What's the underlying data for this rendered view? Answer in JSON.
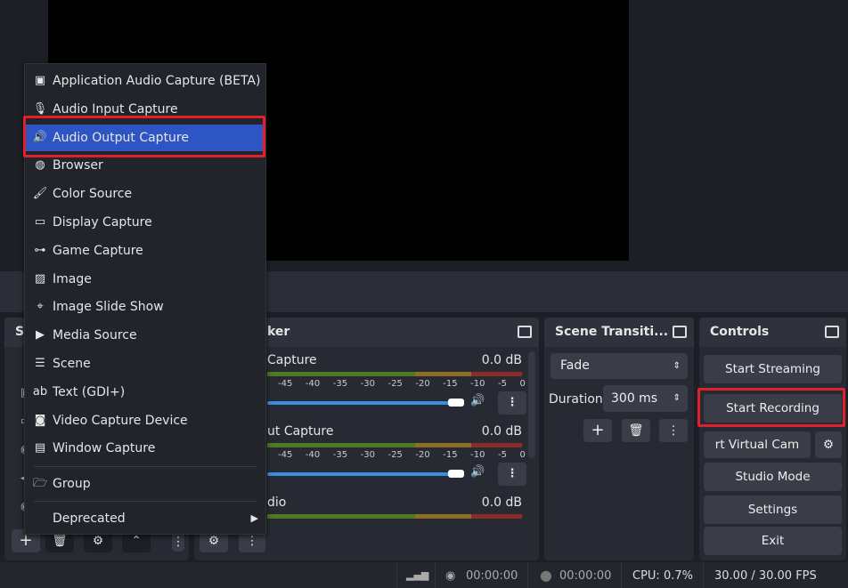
{
  "menu": {
    "items": [
      {
        "label": "Application Audio Capture (BETA)",
        "icon": "app-audio-icon"
      },
      {
        "label": "Audio Input Capture",
        "icon": "microphone-icon"
      },
      {
        "label": "Audio Output Capture",
        "icon": "speaker-icon",
        "selected": true
      },
      {
        "label": "Browser",
        "icon": "globe-icon"
      },
      {
        "label": "Color Source",
        "icon": "brush-icon"
      },
      {
        "label": "Display Capture",
        "icon": "monitor-icon"
      },
      {
        "label": "Game Capture",
        "icon": "gamepad-icon"
      },
      {
        "label": "Image",
        "icon": "image-icon"
      },
      {
        "label": "Image Slide Show",
        "icon": "slideshow-icon"
      },
      {
        "label": "Media Source",
        "icon": "play-icon"
      },
      {
        "label": "Scene",
        "icon": "list-icon"
      },
      {
        "label": "Text (GDI+)",
        "icon": "text-icon"
      },
      {
        "label": "Video Capture Device",
        "icon": "camera-icon"
      },
      {
        "label": "Window Capture",
        "icon": "window-icon"
      }
    ],
    "group": "Group",
    "deprecated": "Deprecated"
  },
  "sources": {
    "title": "S"
  },
  "mixer": {
    "title": "ker",
    "channels": [
      {
        "name": "Capture",
        "db": "0.0 dB"
      },
      {
        "name": "ut Capture",
        "db": "0.0 dB"
      },
      {
        "name": "dio",
        "db": "0.0 dB"
      }
    ],
    "ticks": [
      "-45",
      "-40",
      "-35",
      "-30",
      "-25",
      "-20",
      "-15",
      "-10",
      "-5",
      "0"
    ]
  },
  "transitions": {
    "title": "Scene Transiti...",
    "selected": "Fade",
    "duration_label": "Duration",
    "duration": "300 ms"
  },
  "controls": {
    "title": "Controls",
    "start_streaming": "Start Streaming",
    "start_recording": "Start Recording",
    "virtual_cam": "rt Virtual Cam",
    "studio_mode": "Studio Mode",
    "settings": "Settings",
    "exit": "Exit"
  },
  "status": {
    "stream_time": "00:00:00",
    "rec_time": "00:00:00",
    "cpu": "CPU: 0.7%",
    "fps": "30.00 / 30.00 FPS"
  },
  "colors": {
    "accent": "#2e55c4",
    "highlight": "#e0202a",
    "slider": "#3d8ee0"
  }
}
